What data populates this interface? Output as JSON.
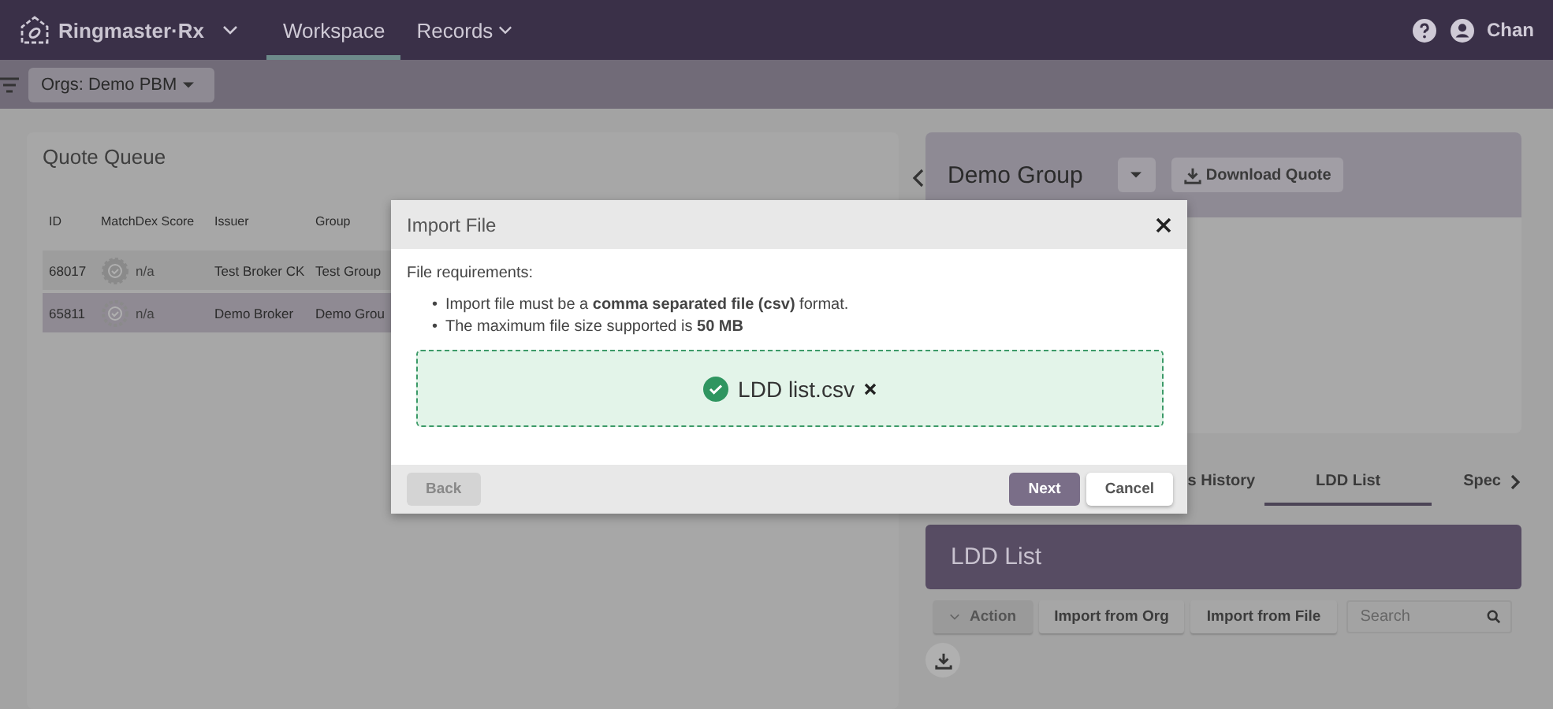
{
  "header": {
    "brand": "Ringmaster·Rx",
    "nav": [
      {
        "label": "Workspace",
        "selected": true,
        "has_menu": false
      },
      {
        "label": "Records",
        "selected": false,
        "has_menu": true
      }
    ],
    "user": "Chan"
  },
  "subbar": {
    "org_selector": "Orgs: Demo PBM"
  },
  "quote_queue": {
    "title": "Quote Queue",
    "columns": [
      "ID",
      "MatchDex Score",
      "Issuer",
      "Group"
    ],
    "rows": [
      {
        "id": "68017",
        "score": "n/a",
        "issuer": "Test Broker CK",
        "group": "Test Group",
        "selected": false
      },
      {
        "id": "65811",
        "score": "n/a",
        "issuer": "Demo Broker",
        "group": "Demo Grou",
        "selected": true
      }
    ]
  },
  "group_panel": {
    "title": "Demo Group",
    "download_button": "Download Quote",
    "tabs": [
      {
        "label": "s History",
        "selected": false
      },
      {
        "label": "LDD List",
        "selected": true
      },
      {
        "label": "Spec",
        "selected": false
      }
    ],
    "ldd_title": "LDD List",
    "action_button": "Action",
    "buttons": [
      "Import from Org",
      "Import from File"
    ],
    "search": {
      "placeholder": "Search"
    }
  },
  "modal": {
    "title": "Import File",
    "bullet": "•",
    "intro": "File requirements:",
    "requirements": [
      "Import file must be a **comma separated file (csv)** format.",
      "The maximum file size supported is **50 MB**"
    ],
    "file": {
      "name": "LDD list.csv",
      "uploaded": true
    },
    "buttons": [
      {
        "label": "Back",
        "disabled": true,
        "primary": false
      },
      {
        "label": "Next",
        "disabled": false,
        "primary": true
      },
      {
        "label": "Cancel",
        "disabled": false,
        "primary": false
      }
    ]
  }
}
